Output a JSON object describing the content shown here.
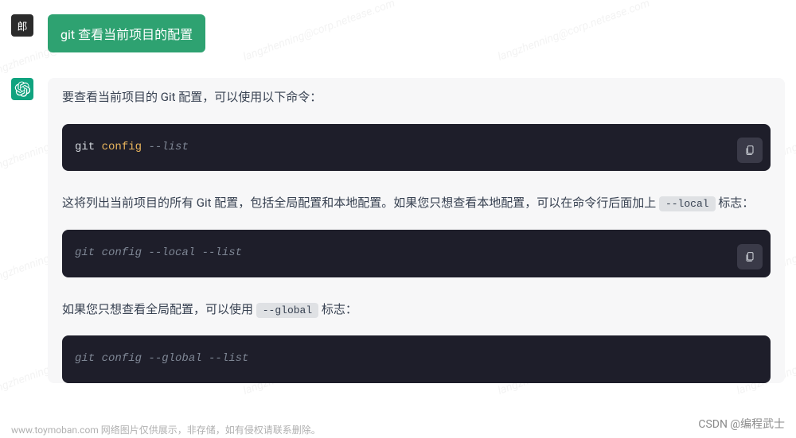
{
  "watermark_text": "langzhenning@corp.netease.com",
  "user": {
    "avatar_label": "郎",
    "message": "git 查看当前项目的配置"
  },
  "bot": {
    "para1": "要查看当前项目的 Git 配置，可以使用以下命令：",
    "code1": {
      "git": "git",
      "config": "config",
      "flag": "--list"
    },
    "para2_prefix": "这将列出当前项目的所有 Git 配置，包括全局配置和本地配置。如果您只想查看本地配置，可以在命令行后面加上 ",
    "para2_code": "--local",
    "para2_suffix": " 标志：",
    "code2": {
      "parts": "git config --local --list"
    },
    "para3_prefix": "如果您只想查看全局配置，可以使用 ",
    "para3_code": "--global",
    "para3_suffix": " 标志：",
    "code3": {
      "parts": "git config --global --list"
    }
  },
  "footer_left": "www.toymoban.com 网络图片仅供展示，非存储，如有侵权请联系删除。",
  "footer_right": "CSDN @编程武士"
}
